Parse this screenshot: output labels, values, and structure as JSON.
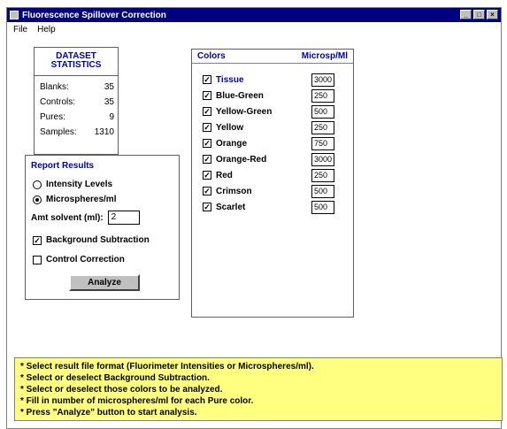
{
  "window": {
    "title": "Fluorescence Spillover Correction",
    "buttons": [
      "_",
      "□",
      "×"
    ]
  },
  "menu": [
    "File",
    "Help"
  ],
  "stats": {
    "title_line1": "DATASET",
    "title_line2": "STATISTICS",
    "rows": [
      {
        "label": "Blanks:",
        "value": "35"
      },
      {
        "label": "Controls:",
        "value": "35"
      },
      {
        "label": "Pures:",
        "value": "9"
      },
      {
        "label": "Samples:",
        "value": "1310"
      }
    ]
  },
  "report": {
    "title": "Report Results",
    "intensity_label": "Intensity Levels",
    "microspheres_label": "Microspheres/ml",
    "selected": "microspheres",
    "solvent_label": "Amt solvent (ml):",
    "solvent_value": "2",
    "bg_label": "Background Subtraction",
    "bg_checked": true,
    "control_label": "Control Correction",
    "control_checked": false,
    "analyze_label": "Analyze"
  },
  "colors": {
    "header_left": "Colors",
    "header_right": "Microsp/Ml",
    "items": [
      {
        "name": "Tissue",
        "value": "3000",
        "highlight": true
      },
      {
        "name": "Blue-Green",
        "value": "250"
      },
      {
        "name": "Yellow-Green",
        "value": "500"
      },
      {
        "name": "Yellow",
        "value": "250"
      },
      {
        "name": "Orange",
        "value": "750"
      },
      {
        "name": "Orange-Red",
        "value": "3000"
      },
      {
        "name": "Red",
        "value": "250"
      },
      {
        "name": "Crimson",
        "value": "500"
      },
      {
        "name": "Scarlet",
        "value": "500"
      }
    ]
  },
  "instructions": [
    "* Select result file format (Fluorimeter Intensities or Microspheres/ml).",
    "* Select or deselect Background Subtraction.",
    "* Select or deselect those colors to be analyzed.",
    "* Fill in number of microspheres/ml for each Pure color.",
    "* Press \"Analyze\" button to start analysis."
  ],
  "accent": {
    "titlebar": "#000080",
    "heading": "#0000aa",
    "info_bg": "#ffff80"
  }
}
